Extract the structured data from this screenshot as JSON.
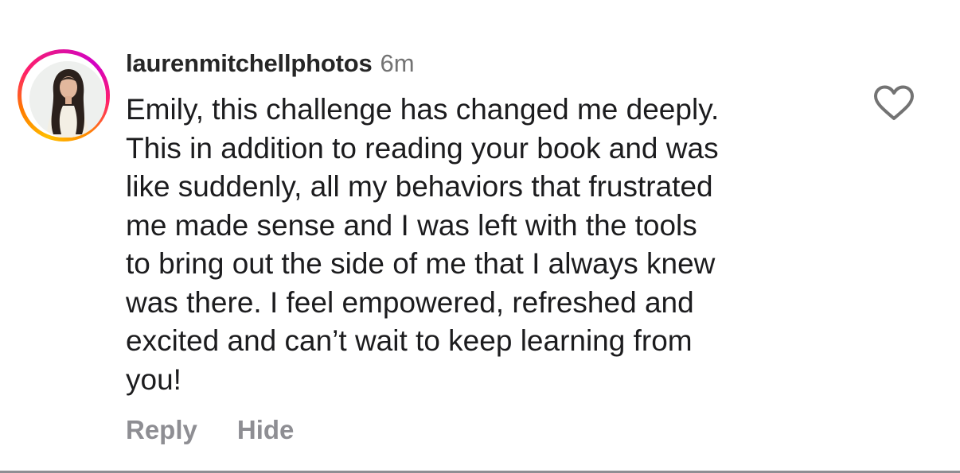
{
  "comment": {
    "username": "laurenmitchellphotos",
    "timestamp": "6m",
    "text_lines": [
      "Emily, this challenge has changed me deeply.",
      "This in addition to reading your book and was",
      "like suddenly, all my behaviors that frustrated",
      "me made sense and I was left with the tools",
      "to bring out the side of me that I always knew",
      "was there. I feel empowered, refreshed and",
      "excited and can’t wait to keep learning from",
      "you!"
    ],
    "liked": false
  },
  "actions": {
    "reply_label": "Reply",
    "hide_label": "Hide"
  },
  "icons": {
    "avatar": "avatar",
    "like": "heart-outline-icon"
  },
  "colors": {
    "username": "#262626",
    "timestamp": "#737373",
    "body_text": "#1c1c1e",
    "action_text": "#8e8e93",
    "story_ring_gradient": [
      "#ffbf00",
      "#ff7a00",
      "#ff1f6b",
      "#d300c5"
    ]
  }
}
